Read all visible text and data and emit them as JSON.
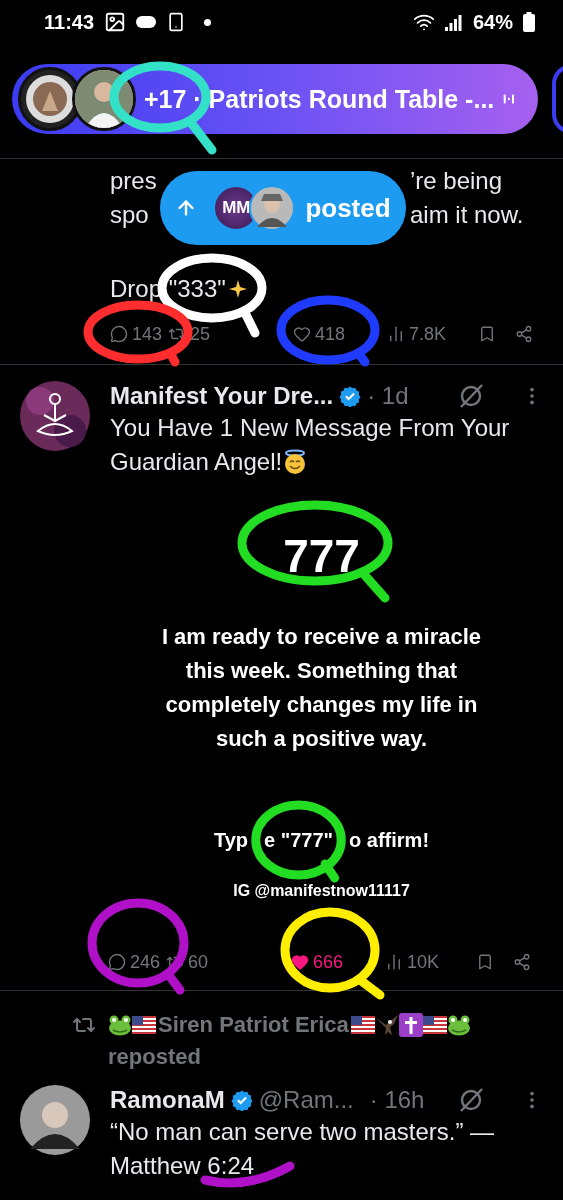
{
  "status_bar": {
    "time": "11:43",
    "battery": "64%"
  },
  "space": {
    "title": "+17 · Patriots Round Table -..."
  },
  "posted_pill": {
    "avatar_text": "MM",
    "label": "posted"
  },
  "partial_post": {
    "lines": [
      [
        "pres",
        "’re being"
      ],
      [
        "spo",
        "aim it now."
      ]
    ],
    "closing": "Drop \"333\"",
    "stats": [
      {
        "kind": "reply",
        "count": "143"
      },
      {
        "kind": "repost",
        "count": "25"
      },
      {
        "kind": "like",
        "count": "418",
        "liked": false
      },
      {
        "kind": "views",
        "count": "7.8K"
      },
      {
        "kind": "bookmark"
      },
      {
        "kind": "share"
      }
    ]
  },
  "post": {
    "author": "Manifest Your Dre...",
    "verified": true,
    "time": "· 1d",
    "text_lines": [
      "You Have 1 New Message From Your",
      "Guardian Angel!"
    ],
    "media": {
      "number": "777",
      "message": "I am ready to receive a miracle this week. Something that completely changes my life in such a positive way.",
      "call": [
        "Typ",
        "e \"777\"",
        "o affirm!"
      ],
      "call_ring": {
        "color": "#22dd22"
      },
      "credit": "IG @manifestnow11117"
    },
    "stats": [
      {
        "kind": "reply",
        "count": "246"
      },
      {
        "kind": "repost",
        "count": "60"
      },
      {
        "kind": "like",
        "count": "666",
        "liked": true
      },
      {
        "kind": "views",
        "count": "10K"
      },
      {
        "kind": "bookmark"
      },
      {
        "kind": "share"
      }
    ]
  },
  "repost_header": {
    "before": [
      {
        "kind": "frog"
      },
      {
        "kind": "flag"
      }
    ],
    "name": "Siren Patriot Erica",
    "after": [
      {
        "kind": "flag"
      },
      {
        "kind": "eagle"
      },
      {
        "kind": "cross"
      },
      {
        "kind": "flag"
      },
      {
        "kind": "frog"
      }
    ],
    "label": "reposted"
  },
  "next_post": {
    "author": "RamonaM",
    "verified": true,
    "handle": "@Ram...",
    "time": "· 16h",
    "text": "“No man can serve two masters.” — Matthew 6:24"
  },
  "annotations": [
    {
      "kind": "ring",
      "color": "#33e0c8"
    },
    {
      "kind": "ring",
      "color": "#ffffff"
    },
    {
      "kind": "ring",
      "color": "#ff2d2d"
    },
    {
      "kind": "ring",
      "color": "#1f3bff"
    },
    {
      "kind": "ring",
      "color": "#22dd22"
    },
    {
      "kind": "ring",
      "color": "#b010c8"
    },
    {
      "kind": "ring",
      "color": "#ffee00"
    },
    {
      "kind": "underline",
      "color": "#b010c8"
    }
  ]
}
